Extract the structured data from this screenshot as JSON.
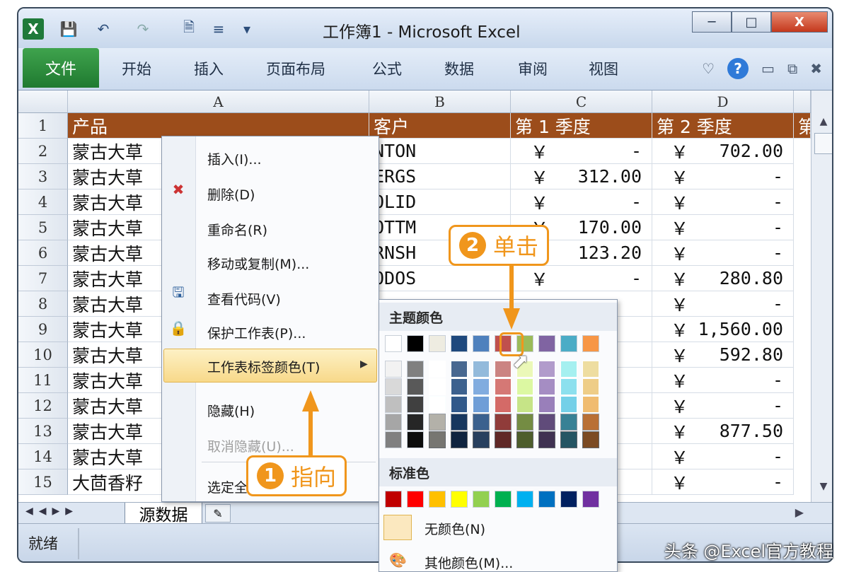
{
  "window": {
    "title": "工作簿1 - Microsoft Excel"
  },
  "ribbon": {
    "file_tab": "文件",
    "tabs": [
      "开始",
      "插入",
      "页面布局",
      "公式",
      "数据",
      "审阅",
      "视图"
    ]
  },
  "columns": [
    "A",
    "B",
    "C",
    "D"
  ],
  "rows": [
    "1",
    "2",
    "3",
    "4",
    "5",
    "6",
    "7",
    "8",
    "9",
    "10",
    "11",
    "12",
    "13",
    "14",
    "15"
  ],
  "header_row": {
    "a": "产品",
    "b": "客户",
    "c": "第 1 季度",
    "d": "第 2 季度",
    "e": "第"
  },
  "cells_a": [
    "蒙古大草",
    "蒙古大草",
    "蒙古大草",
    "蒙古大草",
    "蒙古大草",
    "蒙古大草",
    "蒙古大草",
    "蒙古大草",
    "蒙古大草",
    "蒙古大草",
    "蒙古大草",
    "蒙古大草",
    "蒙古大草",
    "大茴香籽"
  ],
  "cells_b": [
    "NTON",
    "ERGS",
    "OLID",
    "OTTM",
    "RNSH",
    "ODOS"
  ],
  "cells_c": [
    "-",
    "312.00",
    "-",
    "170.00",
    "123.20",
    "-"
  ],
  "cells_d": [
    "702.00",
    "-",
    "-",
    "-",
    "-",
    "280.80",
    "-",
    "1,560.00",
    "592.80",
    "-",
    "-",
    "877.50",
    "-",
    "-"
  ],
  "currency": "￥",
  "context_menu": {
    "insert": "插入(I)...",
    "delete": "删除(D)",
    "rename": "重命名(R)",
    "move_copy": "移动或复制(M)...",
    "view_code": "查看代码(V)",
    "protect": "保护工作表(P)...",
    "tab_color": "工作表标签颜色(T)",
    "hide": "隐藏(H)",
    "unhide": "取消隐藏(U)...",
    "select_all": "选定全"
  },
  "palette": {
    "theme_label": "主题颜色",
    "standard_label": "标准色",
    "no_color": "无颜色(N)",
    "more_colors": "其他颜色(M)...",
    "theme_colors": [
      "#ffffff",
      "#000000",
      "#eeece1",
      "#1f497d",
      "#4f81bd",
      "#c0504d",
      "#9bbb59",
      "#8064a2",
      "#4bacc6",
      "#f79646"
    ],
    "standard_colors": [
      "#c00000",
      "#ff0000",
      "#ffc000",
      "#ffff00",
      "#92d050",
      "#00b050",
      "#00b0f0",
      "#0070c0",
      "#002060",
      "#7030a0"
    ]
  },
  "sheet": {
    "tab_name": "源数据"
  },
  "status": {
    "ready": "就绪"
  },
  "callouts": {
    "step1_num": "1",
    "step1_text": "指向",
    "step2_num": "2",
    "step2_text": "单击"
  },
  "watermark": "头条 @Excel官方教程"
}
